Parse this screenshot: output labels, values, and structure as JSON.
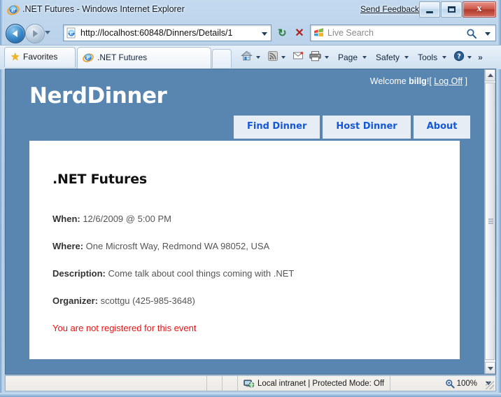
{
  "window": {
    "title": ".NET Futures - Windows Internet Explorer",
    "send_feedback": "Send Feedback",
    "minimize_label": "Minimize",
    "maximize_label": "Maximize",
    "close_label": "x"
  },
  "nav": {
    "back_label": "Back",
    "forward_label": "Forward",
    "recent_pages_label": "Recent Pages",
    "refresh_glyph": "↻",
    "stop_glyph": "✕"
  },
  "address": {
    "url": "http://localhost:60848/Dinners/Details/1",
    "dropdown_label": "Address history"
  },
  "search": {
    "placeholder": "Live Search",
    "provider": "Live Search"
  },
  "tabs_bar": {
    "favorites_label": "Favorites",
    "tab_title": ".NET Futures",
    "new_tab_label": "New Tab"
  },
  "command_bar": {
    "home_label": "Home",
    "feeds_label": "Feeds",
    "mail_label": "Read Mail",
    "print_label": "Print",
    "page_label": "Page",
    "safety_label": "Safety",
    "tools_label": "Tools",
    "help_label": "Help",
    "overflow_label": "»"
  },
  "site": {
    "brand": "NerdDinner",
    "welcome_prefix": "Welcome ",
    "user": "billg",
    "welcome_suffix": "!",
    "logoff_open": "[ ",
    "logoff_label": "Log Off",
    "logoff_close": " ]",
    "nav_tabs": [
      {
        "label": "Find Dinner"
      },
      {
        "label": "Host Dinner"
      },
      {
        "label": "About"
      }
    ],
    "colors": {
      "page_background": "#5886b0",
      "nav_tab_background": "#e7edf5",
      "nav_tab_text": "#1457d8",
      "content_background": "#ffffff",
      "error_text": "#ee1111"
    }
  },
  "dinner": {
    "title": ".NET Futures",
    "when_label": "When:",
    "when_value": " 12/6/2009 @ 5:00 PM",
    "where_label": "Where:",
    "where_value": " One Microsft Way, Redmond WA 98052, USA",
    "description_label": "Description:",
    "description_value": " Come talk about cool things coming with .NET",
    "organizer_label": "Organizer:",
    "organizer_value": " scottgu (425-985-3648)",
    "registration_status": "You are not registered for this event"
  },
  "status_bar": {
    "zone_text": "Local intranet | Protected Mode: Off",
    "zoom_level": "100%"
  }
}
